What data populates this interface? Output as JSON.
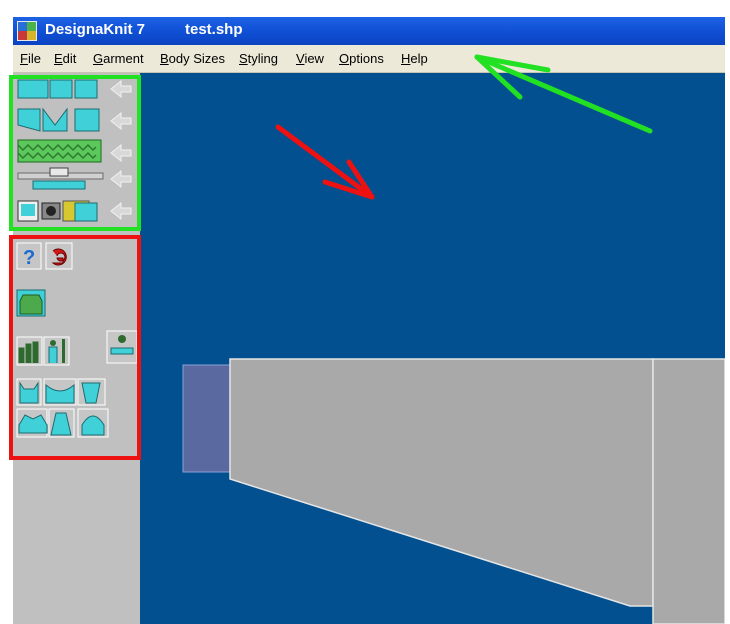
{
  "window": {
    "app_title": "DesignaKnit 7",
    "document_title": "test.shp"
  },
  "menu": [
    "File",
    "Edit",
    "Garment",
    "Body Sizes",
    "Styling",
    "View",
    "Options",
    "Help"
  ],
  "menu_accesskeys": [
    "F",
    "E",
    "G",
    "B",
    "S",
    "V",
    "O",
    "H"
  ],
  "toolbar": {
    "help_glyph": "?",
    "annotation_colors": {
      "green": "#22e022",
      "red": "#ee1111"
    }
  },
  "canvas": {
    "background": "#02508f",
    "piece_color": "#a9a9a9",
    "cuff_color": "#5a6aa0"
  }
}
